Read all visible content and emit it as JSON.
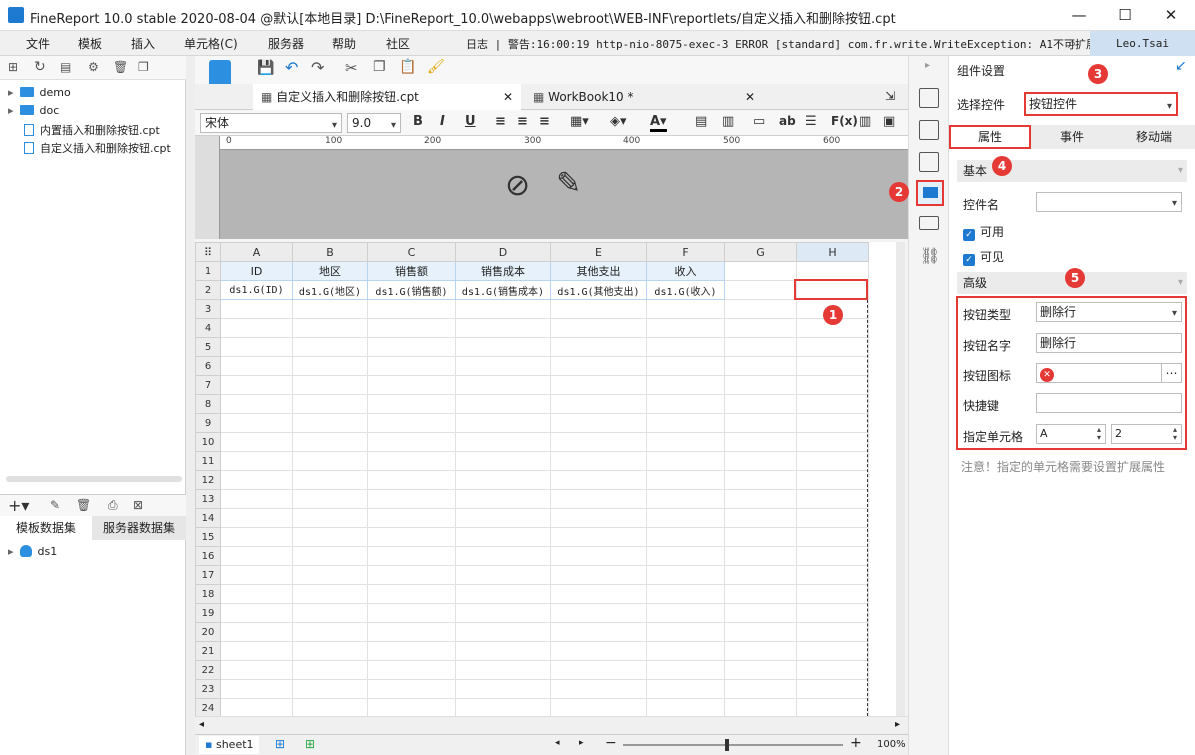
{
  "window": {
    "title": "FineReport 10.0 stable 2020-08-04 @默认[本地目录]    D:\\FineReport_10.0\\webapps\\webroot\\WEB-INF\\reportlets/自定义插入和删除按钮.cpt",
    "minimize": "—",
    "maximize": "☐",
    "close": "✕"
  },
  "menu": {
    "items": [
      "文件",
      "模板",
      "插入",
      "单元格(C)",
      "服务器",
      "帮助",
      "社区"
    ],
    "log": "日志 | 警告:16:00:19 http-nio-8075-exec-3 ERROR [standard] com.fr.write.WriteException: A1不可扩展",
    "user": "Leo.Tsai"
  },
  "left": {
    "tree": [
      {
        "label": "demo",
        "type": "folder"
      },
      {
        "label": "doc",
        "type": "folder"
      },
      {
        "label": "内置插入和删除按钮.cpt",
        "type": "file"
      },
      {
        "label": "自定义插入和删除按钮.cpt",
        "type": "file"
      }
    ],
    "ds_tabs": [
      "模板数据集",
      "服务器数据集"
    ],
    "datasets": [
      "ds1"
    ]
  },
  "editor": {
    "tabs": [
      "自定义插入和删除按钮.cpt",
      "WorkBook10 *"
    ],
    "font": "宋体",
    "size": "9.0",
    "ruler": [
      "0",
      "100",
      "200",
      "300",
      "400",
      "500",
      "600"
    ],
    "columns": [
      "A",
      "B",
      "C",
      "D",
      "E",
      "F",
      "G",
      "H"
    ],
    "row1": [
      "ID",
      "地区",
      "销售额",
      "销售成本",
      "其他支出",
      "收入",
      "",
      ""
    ],
    "row2": [
      "ds1.G(ID)",
      "ds1.G(地区)",
      "ds1.G(销售额)",
      "ds1.G(销售成本)",
      "ds1.G(其他支出)",
      "ds1.G(收入)",
      "",
      ""
    ],
    "rows": [
      "1",
      "2",
      "3",
      "4",
      "5",
      "6",
      "7",
      "8",
      "9",
      "10",
      "11",
      "12",
      "13",
      "14",
      "15",
      "16",
      "17",
      "18",
      "19",
      "20",
      "21",
      "22",
      "23",
      "24"
    ],
    "sheet": "sheet1",
    "zoom": "100%"
  },
  "panel": {
    "title": "组件设置",
    "select_label": "选择控件",
    "select_value": "按钮控件",
    "tabs": [
      "属性",
      "事件",
      "移动端"
    ],
    "basic": "基本",
    "name_label": "控件名",
    "name_value": "",
    "enabled": "可用",
    "visible": "可见",
    "advanced": "高级",
    "btn_type_label": "按钮类型",
    "btn_type_value": "删除行",
    "btn_name_label": "按钮名字",
    "btn_name_value": "删除行",
    "btn_icon_label": "按钮图标",
    "shortcut_label": "快捷键",
    "shortcut_value": "",
    "cell_label": "指定单元格",
    "cell_col": "A",
    "cell_row": "2",
    "note": "注意！指定的单元格需要设置扩展属性"
  },
  "badges": [
    "1",
    "2",
    "3",
    "4",
    "5"
  ],
  "colors": {
    "accent": "#1e7ad1",
    "highlight": "#e53935"
  }
}
